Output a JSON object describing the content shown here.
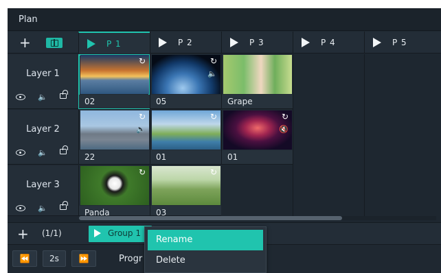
{
  "panel": {
    "title": "Plan"
  },
  "header": {
    "add_label": "+",
    "columns": [
      {
        "label": "P 1",
        "active": true
      },
      {
        "label": "P 2",
        "active": false
      },
      {
        "label": "P 3",
        "active": false
      },
      {
        "label": "P 4",
        "active": false
      },
      {
        "label": "P 5",
        "active": false
      }
    ]
  },
  "layers": [
    {
      "label": "Layer 1"
    },
    {
      "label": "Layer 2"
    },
    {
      "label": "Layer 3"
    }
  ],
  "cells": {
    "l1": [
      {
        "caption": "02",
        "loop": "↻"
      },
      {
        "caption": "05",
        "loop": "↻",
        "volume": "🔈"
      },
      {
        "caption": "Grape"
      }
    ],
    "l2": [
      {
        "caption": "22",
        "loop": "↻",
        "volume": "🔈"
      },
      {
        "caption": "01",
        "loop": "↻"
      },
      {
        "caption": "01",
        "loop": "↻",
        "volume_muted": "🔇"
      }
    ],
    "l3": [
      {
        "caption": "Panda",
        "loop": "↻"
      },
      {
        "caption": "03",
        "loop": "↻"
      }
    ]
  },
  "icons": {
    "eye": "eye-icon",
    "speaker": "🔈",
    "lock": "lock-icon"
  },
  "groups": {
    "add_label": "+",
    "page_count": "(1/1)",
    "tab_label": "Group 1"
  },
  "footer": {
    "prev_label": "⏪",
    "interval": "2s",
    "next_label": "⏩",
    "prog_label": "Progr"
  },
  "context_menu": {
    "items": [
      "Rename",
      "Delete"
    ]
  },
  "colors": {
    "accent": "#20c4ae",
    "muted": "#f07a2a"
  }
}
